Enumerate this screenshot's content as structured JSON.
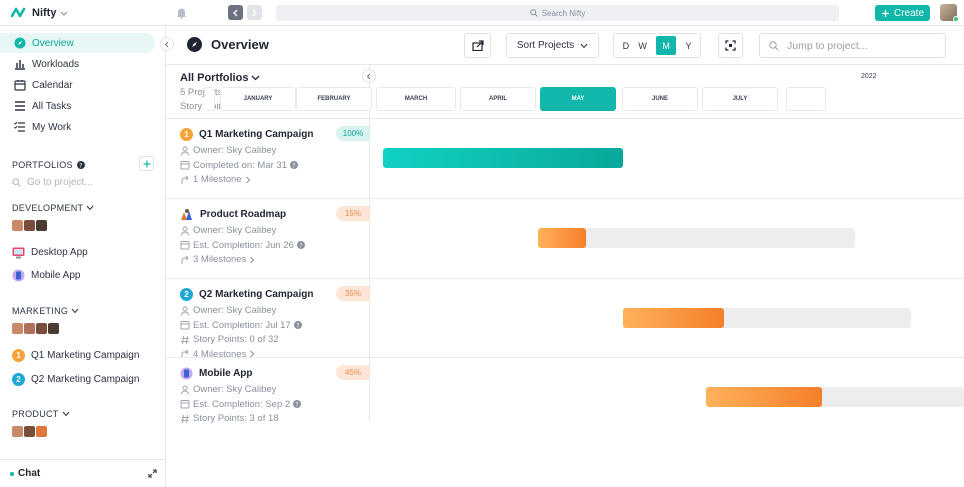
{
  "app": {
    "name": "Nifty"
  },
  "topbar": {
    "search_placeholder": "Search Nifty",
    "create_label": "Create"
  },
  "sidebar": {
    "nav": [
      {
        "label": "Overview",
        "icon": "compass-icon",
        "active": true
      },
      {
        "label": "Workloads",
        "icon": "bar-chart-icon"
      },
      {
        "label": "Calendar",
        "icon": "calendar-icon"
      },
      {
        "label": "All Tasks",
        "icon": "list-icon"
      },
      {
        "label": "My Work",
        "icon": "checklist-icon"
      }
    ],
    "portfolios_label": "PORTFOLIOS",
    "goto_placeholder": "Go to project...",
    "groups": [
      {
        "label": "DEVELOPMENT",
        "projects": [
          {
            "name": "Desktop App",
            "icon": "desktop-icon"
          },
          {
            "name": "Mobile App",
            "icon": "mobile-icon"
          }
        ]
      },
      {
        "label": "MARKETING",
        "projects": [
          {
            "name": "Q1 Marketing Campaign",
            "badge": "1",
            "color": "#f7a33a"
          },
          {
            "name": "Q2 Marketing Campaign",
            "badge": "2",
            "color": "#1fa8d6"
          }
        ]
      },
      {
        "label": "PRODUCT",
        "projects": []
      }
    ],
    "chat_label": "Chat"
  },
  "header": {
    "title": "Overview",
    "sort_label": "Sort Projects",
    "views": [
      "D",
      "W",
      "M",
      "Y"
    ],
    "active_view": "M",
    "jump_placeholder": "Jump to project..."
  },
  "portfolio": {
    "title": "All Portfolios",
    "projects_count": "5 Projects",
    "story_points": "Story Points: 3 of 50"
  },
  "timeline": {
    "year": "2022",
    "months": [
      "JANUARY",
      "FEBRUARY",
      "MARCH",
      "APRIL",
      "MAY",
      "JUNE",
      "JULY"
    ],
    "selected_month": "MAY"
  },
  "projects": [
    {
      "name": "Q1 Marketing Campaign",
      "badge": "1",
      "badge_color": "#f7a33a",
      "meta": [
        "Owner: Sky Calibey",
        "Completed on: Mar 31",
        "1 Milestone"
      ],
      "percent": "100%",
      "progress": 1.0,
      "color": "#0cc6b8"
    },
    {
      "name": "Product Roadmap",
      "meta": [
        "Owner: Sky Calibey",
        "Est. Completion: Jun 26",
        "3 Milestones"
      ],
      "percent": "15%",
      "progress": 0.15,
      "color": "#f57f2a"
    },
    {
      "name": "Q2 Marketing Campaign",
      "badge": "2",
      "badge_color": "#1fa8d6",
      "meta": [
        "Owner: Sky Calibey",
        "Est. Completion: Jul 17",
        "Story Points: 0 of 32",
        "4 Milestones"
      ],
      "percent": "35%",
      "progress": 0.35,
      "color": "#f57f2a"
    },
    {
      "name": "Mobile App",
      "meta": [
        "Owner: Sky Calibey",
        "Est. Completion: Sep 2",
        "Story Points: 3 of 18"
      ],
      "percent": "45%",
      "progress": 0.45,
      "color": "#f57f2a"
    }
  ]
}
